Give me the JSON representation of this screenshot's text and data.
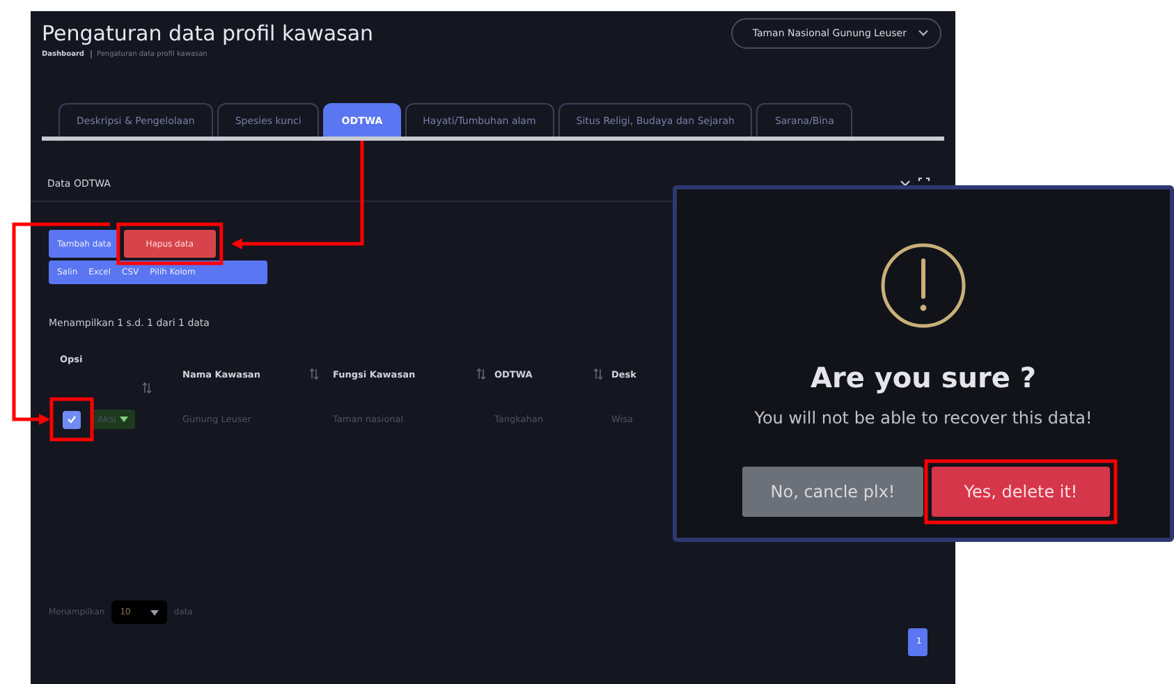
{
  "page": {
    "title": "Pengaturan data profil kawasan",
    "breadcrumb": [
      "Dashboard",
      "Pengaturan data profil kawasan"
    ],
    "region_select": {
      "value": "Taman Nasional Gunung Leuser"
    }
  },
  "tabs": [
    {
      "label": "Deskripsi & Pengelolaan",
      "selected": false
    },
    {
      "label": "Spesies kunci",
      "selected": false
    },
    {
      "label": "ODTWA",
      "selected": true
    },
    {
      "label": "Hayati/Tumbuhan alam",
      "selected": false
    },
    {
      "label": "Situs Religi, Budaya dan Sejarah",
      "selected": false
    },
    {
      "label": "Sarana/Bina",
      "selected": false
    }
  ],
  "card": {
    "title": "Data ODTWA",
    "actions": [
      {
        "label": "Tambah data",
        "kind": "add"
      },
      {
        "label": "Hapus data",
        "kind": "delete"
      }
    ],
    "export_buttons": [
      "Salin",
      "Excel",
      "CSV",
      "Pilih Kolom"
    ],
    "info": "Menampilkan 1 s.d. 1 dari 1 data",
    "table": {
      "columns": [
        "Opsi",
        "Nama Kawasan",
        "Fungsi Kawasan",
        "ODTWA",
        "Desk"
      ],
      "rows": [
        {
          "cells": [
            {
              "kind": "options",
              "checked": true,
              "action": "Aksi"
            },
            {
              "kind": "text",
              "text": "Gunung Leuser"
            },
            {
              "kind": "text",
              "text": "Taman nasional"
            },
            {
              "kind": "text",
              "text": "Tangkahan"
            },
            {
              "kind": "text",
              "text": "Wisa"
            }
          ]
        }
      ]
    },
    "footer": {
      "prefix": "Menampilkan",
      "page_size": "10",
      "suffix": "data"
    },
    "pagination": [
      {
        "label": "1",
        "selected": true
      }
    ]
  },
  "dialog": {
    "title": "Are you sure ?",
    "message": "You will not be able to recover this data!",
    "buttons": [
      {
        "label": "No, cancle plx!",
        "kind": "cancel"
      },
      {
        "label": "Yes, delete it!",
        "kind": "confirm"
      }
    ]
  }
}
